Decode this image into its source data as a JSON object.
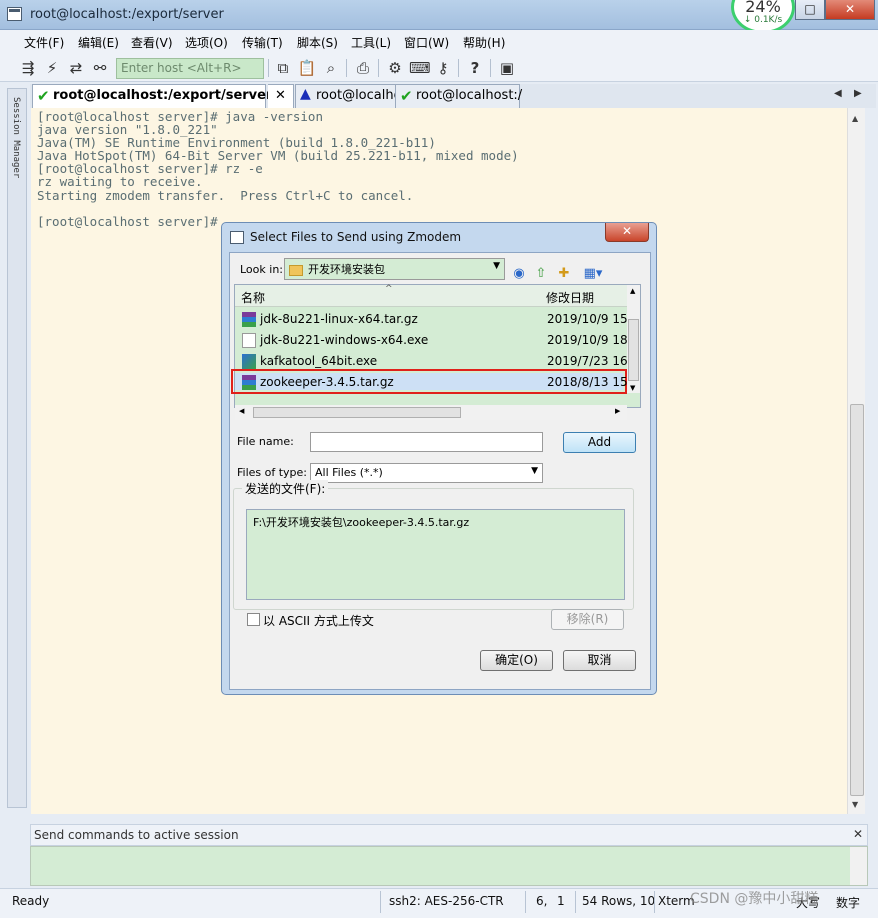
{
  "window": {
    "title": "root@localhost:/export/server"
  },
  "net_monitor": {
    "percent": "24%",
    "speed": "0.1K/s"
  },
  "window_controls": {
    "minimize": "—",
    "maximize": "□",
    "close": "✕"
  },
  "menu": [
    "文件(F)",
    "编辑(E)",
    "查看(V)",
    "选项(O)",
    "传输(T)",
    "脚本(S)",
    "工具(L)",
    "窗口(W)",
    "帮助(H)"
  ],
  "toolbar": {
    "host_placeholder": "Enter host <Alt+R>"
  },
  "session_manager": {
    "label": "Session Manager"
  },
  "tabs": [
    {
      "label": "root@localhost:/export/server",
      "active": true,
      "status": "check"
    },
    {
      "label": "root@localhost:/",
      "active": false,
      "status": "warning"
    },
    {
      "label": "root@localhost:/",
      "active": false,
      "status": "check"
    }
  ],
  "terminal": {
    "lines": [
      "[root@localhost server]# java -version",
      "java version \"1.8.0_221\"",
      "Java(TM) SE Runtime Environment (build 1.8.0_221-b11)",
      "Java HotSpot(TM) 64-Bit Server VM (build 25.221-b11, mixed mode)",
      "[root@localhost server]# rz -e",
      "rz waiting to receive.",
      "Starting zmodem transfer.  Press Ctrl+C to cancel.",
      "",
      "[root@localhost server]#"
    ]
  },
  "dialog": {
    "title": "Select Files to Send using Zmodem",
    "close": "✕",
    "look_in_label": "Look in:",
    "look_in_value": "开发环境安装包",
    "columns": {
      "name": "名称",
      "date": "修改日期"
    },
    "files": [
      {
        "name": "jdk-8u221-linux-x64.tar.gz",
        "date": "2019/10/9 15:",
        "icon": "archive"
      },
      {
        "name": "jdk-8u221-windows-x64.exe",
        "date": "2019/10/9 18:",
        "icon": "exe"
      },
      {
        "name": "kafkatool_64bit.exe",
        "date": "2019/7/23 16:",
        "icon": "app"
      },
      {
        "name": "zookeeper-3.4.5.tar.gz",
        "date": "2018/8/13 15",
        "icon": "archive",
        "selected": true
      }
    ],
    "file_name_label": "File name:",
    "file_name_value": "",
    "add_button": "Add",
    "file_type_label": "Files of type:",
    "file_type_value": "All Files (*.*)",
    "send_group_label": "发送的文件(F):",
    "send_files": [
      "F:\\开发环境安装包\\zookeeper-3.4.5.tar.gz"
    ],
    "ascii_label": "以 ASCII 方式上传文",
    "remove_button": "移除(R)",
    "ok_button": "确定(O)",
    "cancel_button": "取消"
  },
  "send_commands": {
    "label": "Send commands to active session",
    "close": "✕"
  },
  "status": {
    "ready": "Ready",
    "cipher": "ssh2: AES-256-CTR",
    "cursor_row": "6,",
    "cursor_col": "1",
    "rows": "54 Rows, 10",
    "term": "Xterm",
    "caps": "大写",
    "num": "数字"
  },
  "watermark": "CSDN @豫中小甜糕"
}
